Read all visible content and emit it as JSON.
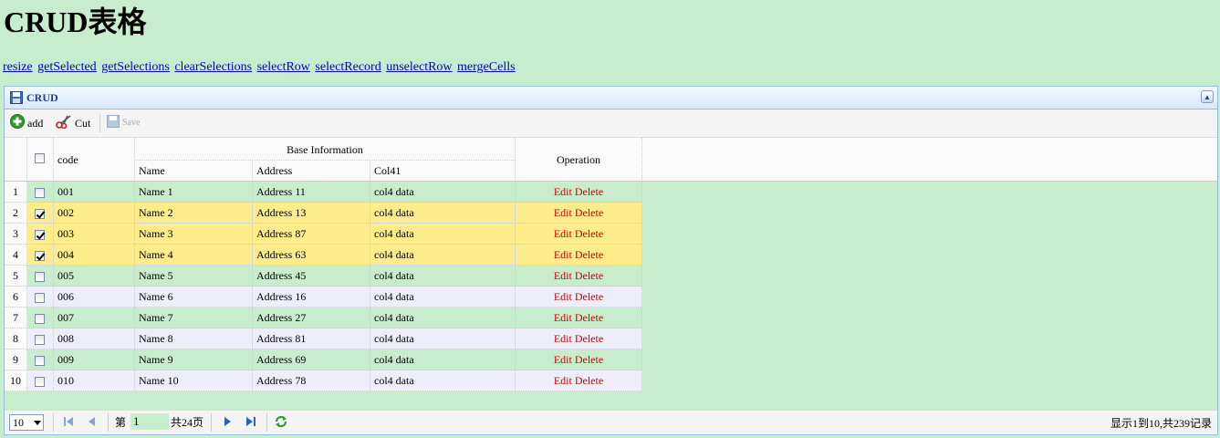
{
  "page": {
    "title": "CRUD表格"
  },
  "links": [
    "resize",
    "getSelected",
    "getSelections",
    "clearSelections",
    "selectRow",
    "selectRecord",
    "unselectRow",
    "mergeCells"
  ],
  "panel": {
    "title": "CRUD"
  },
  "toolbar": {
    "add": "add",
    "cut": "Cut",
    "save": "Save"
  },
  "columns": {
    "code": "code",
    "group": "Base Information",
    "name": "Name",
    "address": "Address",
    "col4": "Col41",
    "operation": "Operation"
  },
  "rows": [
    {
      "num": "1",
      "checked": false,
      "code": "001",
      "name": "Name 1",
      "address": "Address 11",
      "col4": "col4 data",
      "style": "green"
    },
    {
      "num": "2",
      "checked": true,
      "code": "002",
      "name": "Name 2",
      "address": "Address 13",
      "col4": "col4 data",
      "style": "selected"
    },
    {
      "num": "3",
      "checked": true,
      "code": "003",
      "name": "Name 3",
      "address": "Address 87",
      "col4": "col4 data",
      "style": "selected"
    },
    {
      "num": "4",
      "checked": true,
      "code": "004",
      "name": "Name 4",
      "address": "Address 63",
      "col4": "col4 data",
      "style": "selected"
    },
    {
      "num": "5",
      "checked": false,
      "code": "005",
      "name": "Name 5",
      "address": "Address 45",
      "col4": "col4 data",
      "style": "green"
    },
    {
      "num": "6",
      "checked": false,
      "code": "006",
      "name": "Name 6",
      "address": "Address 16",
      "col4": "col4 data",
      "style": "lavender"
    },
    {
      "num": "7",
      "checked": false,
      "code": "007",
      "name": "Name 7",
      "address": "Address 27",
      "col4": "col4 data",
      "style": "green"
    },
    {
      "num": "8",
      "checked": false,
      "code": "008",
      "name": "Name 8",
      "address": "Address 81",
      "col4": "col4 data",
      "style": "lavender"
    },
    {
      "num": "9",
      "checked": false,
      "code": "009",
      "name": "Name 9",
      "address": "Address 69",
      "col4": "col4 data",
      "style": "green"
    },
    {
      "num": "10",
      "checked": false,
      "code": "010",
      "name": "Name 10",
      "address": "Address 78",
      "col4": "col4 data",
      "style": "lavender"
    }
  ],
  "row_actions": {
    "edit": "Edit",
    "delete": "Delete"
  },
  "pager": {
    "page_size": "10",
    "page_prefix": "第",
    "current_page": "1",
    "page_total": "共24页",
    "info": "显示1到10,共239记录"
  },
  "colors": {
    "background": "#c8edcc",
    "selected": "#fcec8c",
    "lavender": "#eeeefa",
    "link": "#0000cc",
    "action": "#cc0000"
  }
}
